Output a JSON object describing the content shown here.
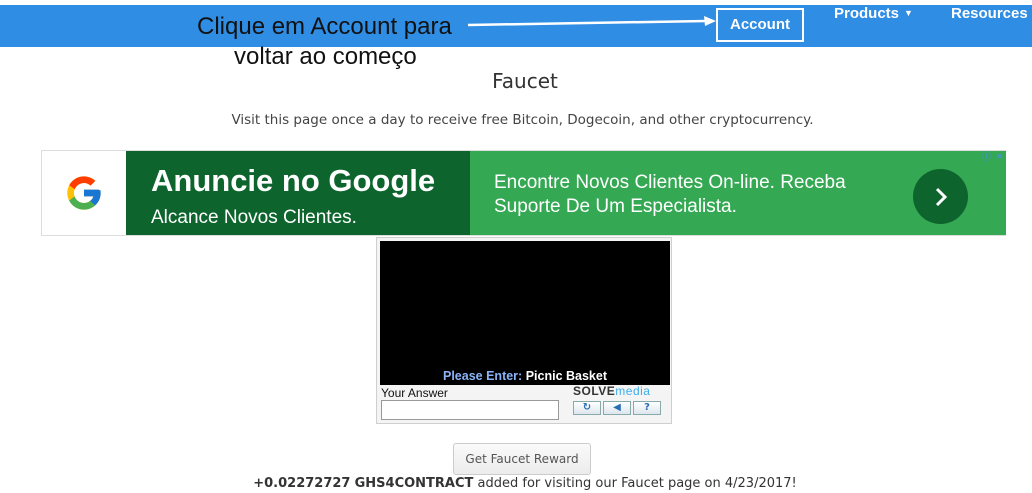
{
  "nav": {
    "account": "Account",
    "products": "Products",
    "resources": "Resources"
  },
  "annotation": {
    "line1": "Clique em Account para",
    "line2": "voltar ao começo"
  },
  "page": {
    "title": "Faucet",
    "description": "Visit this page once a day to receive free Bitcoin, Dogecoin, and other cryptocurrency."
  },
  "ad": {
    "headline": "Anuncie no Google",
    "subline": "Alcance Novos Clientes.",
    "body": "Encontre Novos Clientes On-line. Receba Suporte De Um Especialista.",
    "colors": {
      "dark": "#0d652d",
      "light": "#34a853"
    }
  },
  "captcha": {
    "prompt_label": "Please Enter:",
    "prompt_value": "Picnic Basket",
    "answer_label": "Your Answer",
    "answer_value": "",
    "brand_solve": "SOLVE",
    "brand_media": "media",
    "buttons": [
      "refresh-icon",
      "audio-icon",
      "help-icon"
    ]
  },
  "reward": {
    "button_label": "Get Faucet Reward",
    "amount": "+0.02272727",
    "currency": "GHS4CONTRACT",
    "message": " added for visiting our Faucet page on 4/23/2017!"
  },
  "colors": {
    "navbar": "#2f8de4"
  }
}
